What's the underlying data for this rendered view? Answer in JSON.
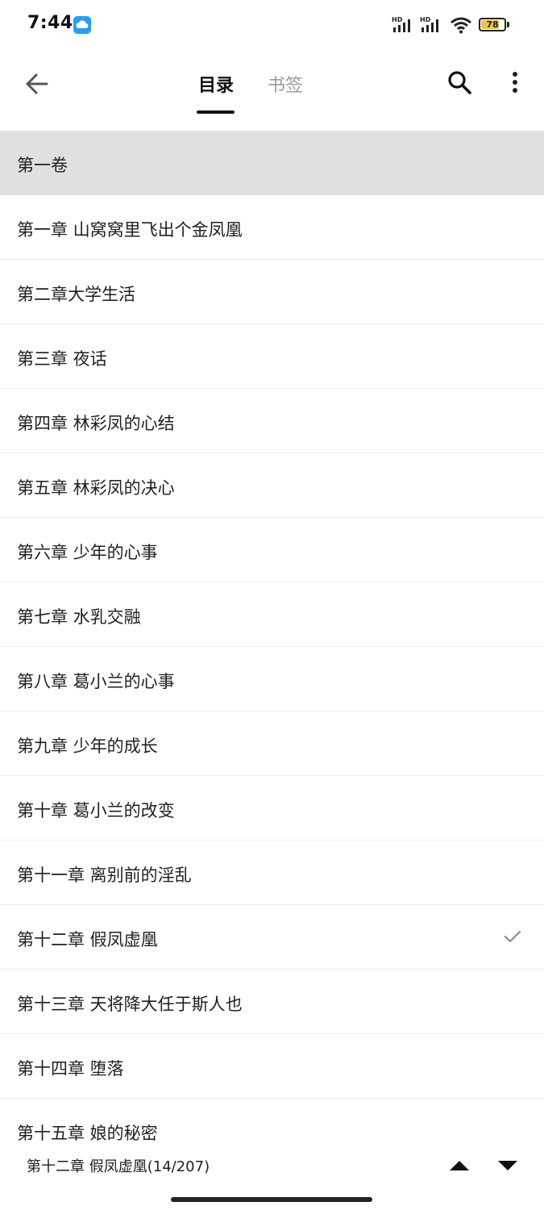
{
  "status_bar": {
    "time": "7:44",
    "signal1_label": "HD",
    "signal2_label": "HD",
    "battery_level": "78",
    "battery_color": "#f1c34a"
  },
  "header": {
    "tabs": [
      {
        "label": "目录",
        "active": true
      },
      {
        "label": "书签",
        "active": false
      }
    ],
    "icons": [
      "back-arrow-icon",
      "search-icon",
      "more-vert-icon"
    ]
  },
  "toc": {
    "volume": "第一卷",
    "chapters": [
      {
        "label": "第一章 山窝窝里飞出个金凤凰"
      },
      {
        "label": "第二章大学生活"
      },
      {
        "label": "第三章 夜话"
      },
      {
        "label": "第四章 林彩凤的心结"
      },
      {
        "label": "第五章 林彩凤的决心"
      },
      {
        "label": "第六章 少年的心事"
      },
      {
        "label": "第七章 水乳交融"
      },
      {
        "label": "第八章 葛小兰的心事"
      },
      {
        "label": "第九章 少年的成长"
      },
      {
        "label": "第十章 葛小兰的改变"
      },
      {
        "label": "第十一章 离别前的淫乱"
      },
      {
        "label": "第十二章 假凤虚凰",
        "current": true
      },
      {
        "label": "第十三章 天将降大任于斯人也"
      },
      {
        "label": "第十四章 堕落"
      },
      {
        "label": "第十五章 娘的秘密"
      }
    ]
  },
  "bottom_bar": {
    "current_chapter": "第十二章 假凤虚凰(14/207)"
  }
}
